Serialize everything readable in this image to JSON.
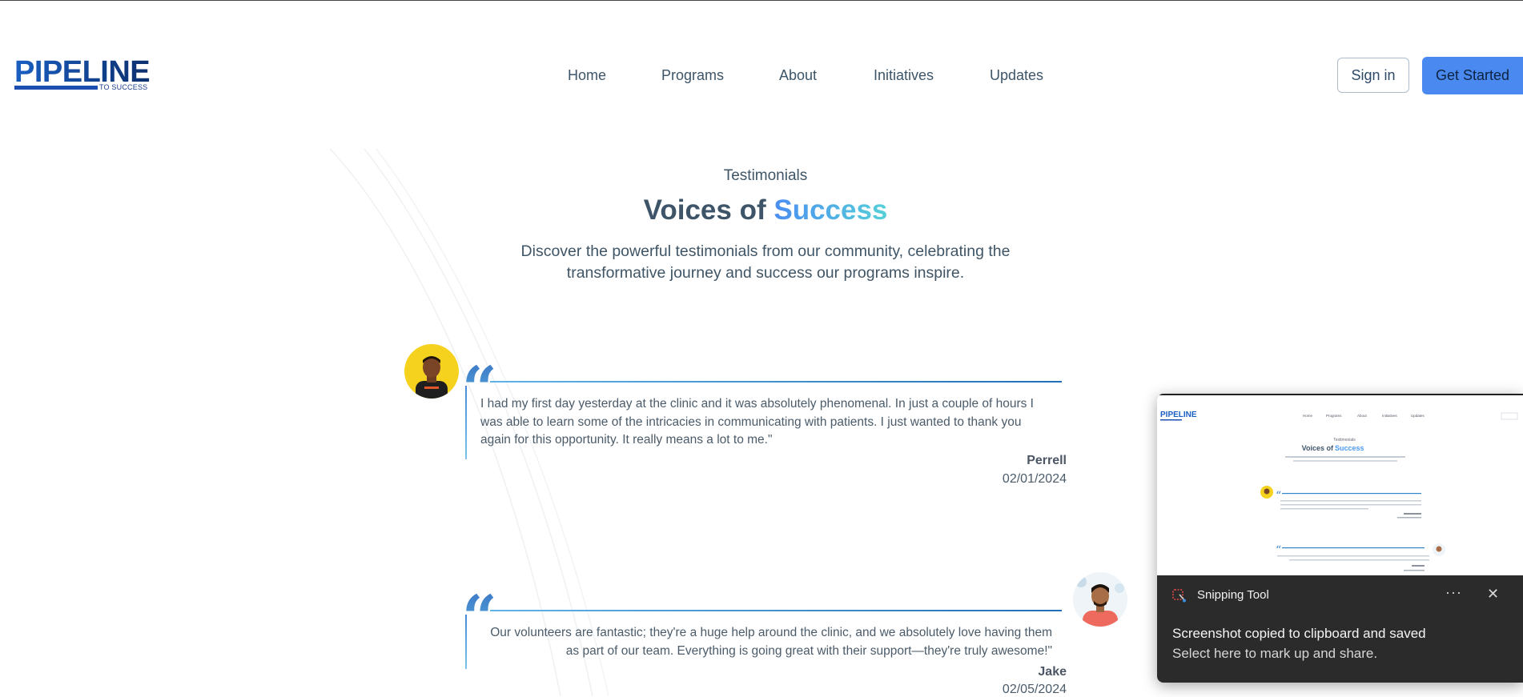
{
  "brand": {
    "name": "PIPELINE",
    "tagline": "TO SUCCESS"
  },
  "nav": {
    "items": [
      {
        "label": "Home"
      },
      {
        "label": "Programs"
      },
      {
        "label": "About"
      },
      {
        "label": "Initiatives"
      },
      {
        "label": "Updates"
      }
    ]
  },
  "auth": {
    "sign_in": "Sign in",
    "get_started": "Get Started"
  },
  "hero": {
    "eyebrow": "Testimonials",
    "title_lead": "Voices of",
    "title_accent": "Success",
    "description": "Discover the powerful testimonials from our community, celebrating the transformative journey and success our programs inspire."
  },
  "testimonials": [
    {
      "text": "I had my first day yesterday at the clinic and it was absolutely phenomenal. In just a couple of hours I was able to learn some of the intricacies in communicating with patients. I just wanted to thank you again for this opportunity. It really means a lot to me.\"",
      "name": "Perrell",
      "date": "02/01/2024"
    },
    {
      "text": "Our volunteers are fantastic; they're a huge help around the clinic, and we absolutely love having them as part of our team. Everything is going great with their support—they're truly awesome!\"",
      "name": "Jake",
      "date": "02/05/2024"
    }
  ],
  "toast": {
    "app_name": "Snipping Tool",
    "message": "Screenshot copied to clipboard and saved",
    "hint": "Select here to mark up and share.",
    "preview_nav": [
      "Home",
      "Programs",
      "About",
      "Initiatives",
      "Updates"
    ],
    "colors": {
      "background": "#2b2b2b",
      "text": "#f5f5f5"
    }
  },
  "colors": {
    "accent": "#4a8af0",
    "accent_gradient_end": "#55d0d8",
    "heading": "#3e5468",
    "brand": "#1b5fc2"
  }
}
